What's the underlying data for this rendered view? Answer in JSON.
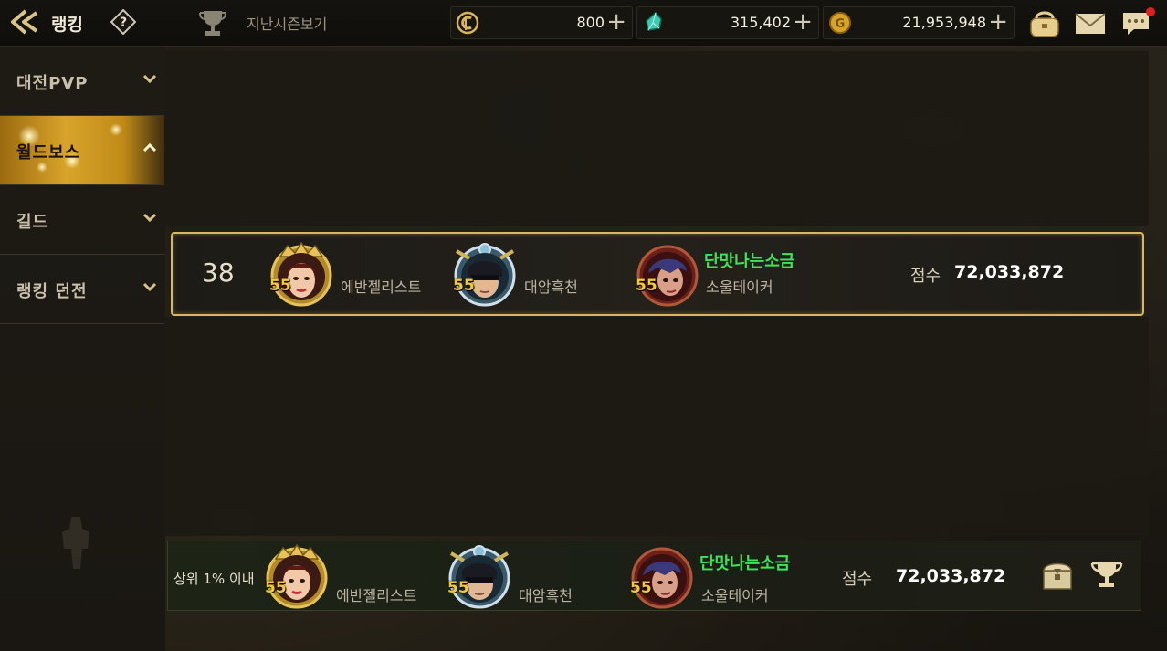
{
  "header": {
    "title": "랭킹",
    "season_label": "지난시즌보기",
    "currencies": [
      {
        "icon": "coin-c-icon",
        "value": "800"
      },
      {
        "icon": "crystal-icon",
        "value": "315,402"
      },
      {
        "icon": "gold-icon",
        "value": "21,953,948"
      }
    ]
  },
  "sidebar": {
    "items": [
      {
        "label": "대전PVP",
        "expanded": false
      },
      {
        "label": "월드보스",
        "expanded": true
      },
      {
        "label": "길드",
        "expanded": false
      },
      {
        "label": "랭킹 던전",
        "expanded": false
      }
    ]
  },
  "my_rank": {
    "rank": "38",
    "heroes": [
      {
        "name": "에반젤리스트",
        "level": "55"
      },
      {
        "name": "대암흑천",
        "level": "55"
      },
      {
        "name": "소울테이커",
        "level": "55"
      }
    ],
    "player_name": "단맛나는소금",
    "score_label": "점수",
    "score": "72,033,872"
  },
  "bottom": {
    "rank_text": "상위 1% 이내",
    "heroes": [
      {
        "name": "에반젤리스트",
        "level": "55"
      },
      {
        "name": "대암흑천",
        "level": "55"
      },
      {
        "name": "소울테이커",
        "level": "55"
      }
    ],
    "player_name": "단맛나는소금",
    "score_label": "점수",
    "score": "72,033,872"
  },
  "colors": {
    "accent_gold": "#d7b760",
    "player_name": "#3fe35a",
    "level": "#f5c93c",
    "notification": "#e02020"
  }
}
